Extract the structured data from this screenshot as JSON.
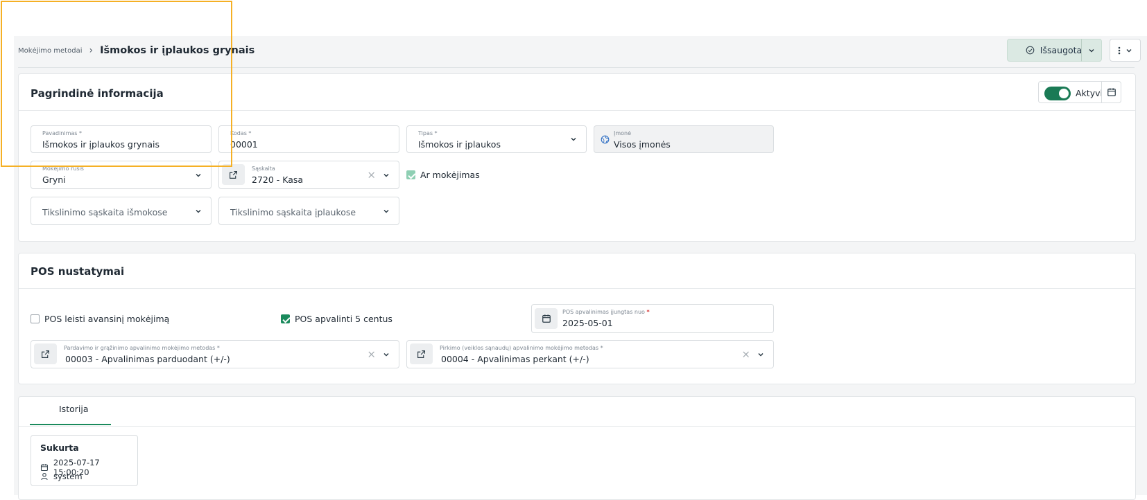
{
  "breadcrumb": {
    "parent": "Mokėjimo metodai",
    "current": "Išmokos ir įplaukos grynais"
  },
  "header": {
    "saved_label": "Išsaugota"
  },
  "main_info": {
    "title": "Pagrindinė informacija",
    "active_label": "Aktyvi",
    "name": {
      "label": "Pavadinimas *",
      "value": "Išmokos ir įplaukos grynais"
    },
    "code": {
      "label": "Kodas *",
      "value": "00001"
    },
    "type": {
      "label": "Tipas *",
      "value": "Išmokos ir įplaukos"
    },
    "company": {
      "label": "Įmonė",
      "value": "Visos įmonės"
    },
    "payment_kind": {
      "label": "Mokėjimo rūšis",
      "value": "Gryni"
    },
    "account": {
      "label": "Sąskaita",
      "value": "2720 - Kasa"
    },
    "is_payment": {
      "label": "Ar mokėjimas",
      "checked": true
    },
    "refine_payouts": {
      "placeholder": "Tikslinimo sąskaita išmokose"
    },
    "refine_receipts": {
      "placeholder": "Tikslinimo sąskaita įplaukose"
    }
  },
  "pos": {
    "title": "POS nustatymai",
    "allow_advance": {
      "label": "POS leisti avansinį mokėjimą",
      "checked": false
    },
    "round_5": {
      "label": "POS apvalinti 5 centus",
      "checked": true
    },
    "rounding_from": {
      "label": "POS apvalinimas įjungtas nuo",
      "value": "2025-05-01"
    },
    "sale_method": {
      "label": "Pardavimo ir grąžinimo apvalinimo mokėjimo metodas *",
      "value": "00003 - Apvalinimas parduodant (+/-)"
    },
    "purchase_method": {
      "label": "Pirkimo (veiklos sąnaudų) apvalinimo mokėjimo metodas *",
      "value": "00004 - Apvalinimas perkant (+/-)"
    }
  },
  "history": {
    "tab_label": "Istorija",
    "created_title": "Sukurta",
    "created_at": "2025-07-17 15:00:20",
    "created_by": "system"
  },
  "colors": {
    "accent": "#1a8a5c",
    "highlight_box": "#f5b025"
  }
}
